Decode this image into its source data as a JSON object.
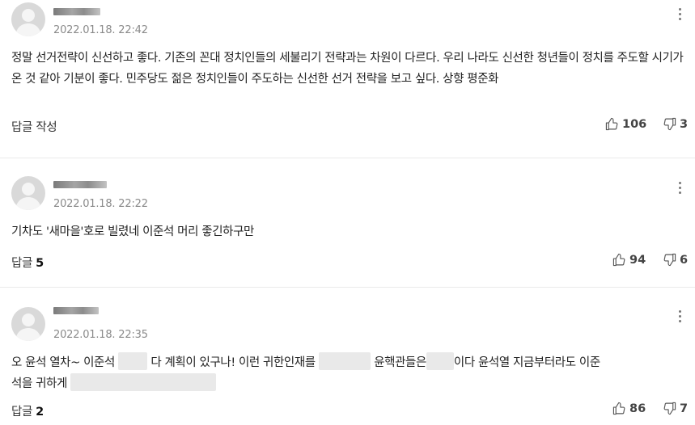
{
  "comments": [
    {
      "date": "2022.01.18. 22:42",
      "text": "정말 선거전략이 신선하고 좋다. 기존의 꼰대 정치인들의 세불리기 전략과는 차원이 다르다. 우리 나라도 신선한 청년들이 정치를 주도할 시기가 온 것 같아 기분이 좋다. 민주당도 젊은 정치인들이 주도하는 신선한 선거 전략을 보고 싶다. 상향 평준화",
      "reply_label": "답글 작성",
      "reply_count": "",
      "likes": "106",
      "dislikes": "3"
    },
    {
      "date": "2022.01.18. 22:22",
      "text": "기차도 '새마을'호로 빌렸네 이준석 머리 좋긴하구만",
      "reply_label": "답글",
      "reply_count": "5",
      "likes": "94",
      "dislikes": "6"
    },
    {
      "date": "2022.01.18. 22:35",
      "text_parts": [
        "오 윤석 열차~ 이준석",
        "다 계획이 있구나! 이런 귀한인재를",
        "윤핵관들은",
        "이다 윤석열 지금부터라도 이준",
        "석을 귀하게"
      ],
      "reply_label": "답글",
      "reply_count": "2",
      "likes": "86",
      "dislikes": "7"
    }
  ]
}
